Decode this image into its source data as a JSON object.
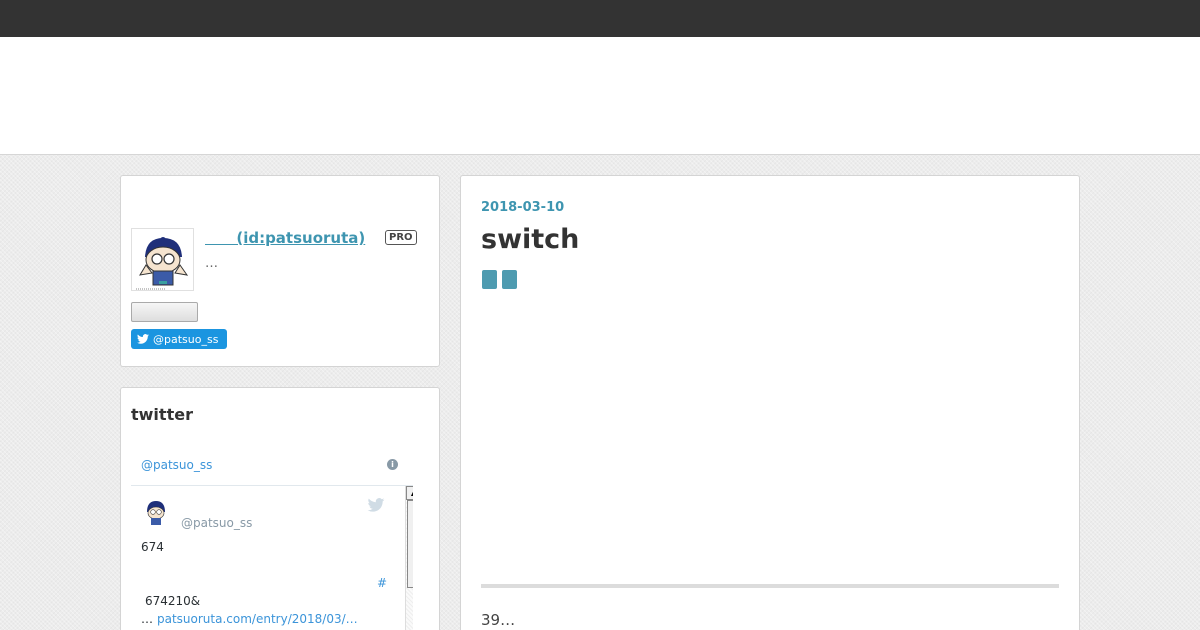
{
  "profile": {
    "name": "      (id:patsuoruta)",
    "pro_badge": "PRO",
    "description": "…",
    "twitter_follow": "@patsuo_ss"
  },
  "twitter_module": {
    "title": "twitter",
    "handle": "@patsuo_ss",
    "tweet": {
      "author": "@patsuo_ss",
      "text1": "674",
      "hashtag": "#",
      "text2": "674210&",
      "text3_prefix": "…",
      "link": "patsuoruta.com/entry/2018/03/…"
    }
  },
  "entry": {
    "date": "2018-03-10",
    "title": "switch",
    "body": "39…"
  },
  "colors": {
    "accent": "#3e95b0",
    "topbar": "#333333",
    "twitter_blue": "#1b95e0"
  }
}
